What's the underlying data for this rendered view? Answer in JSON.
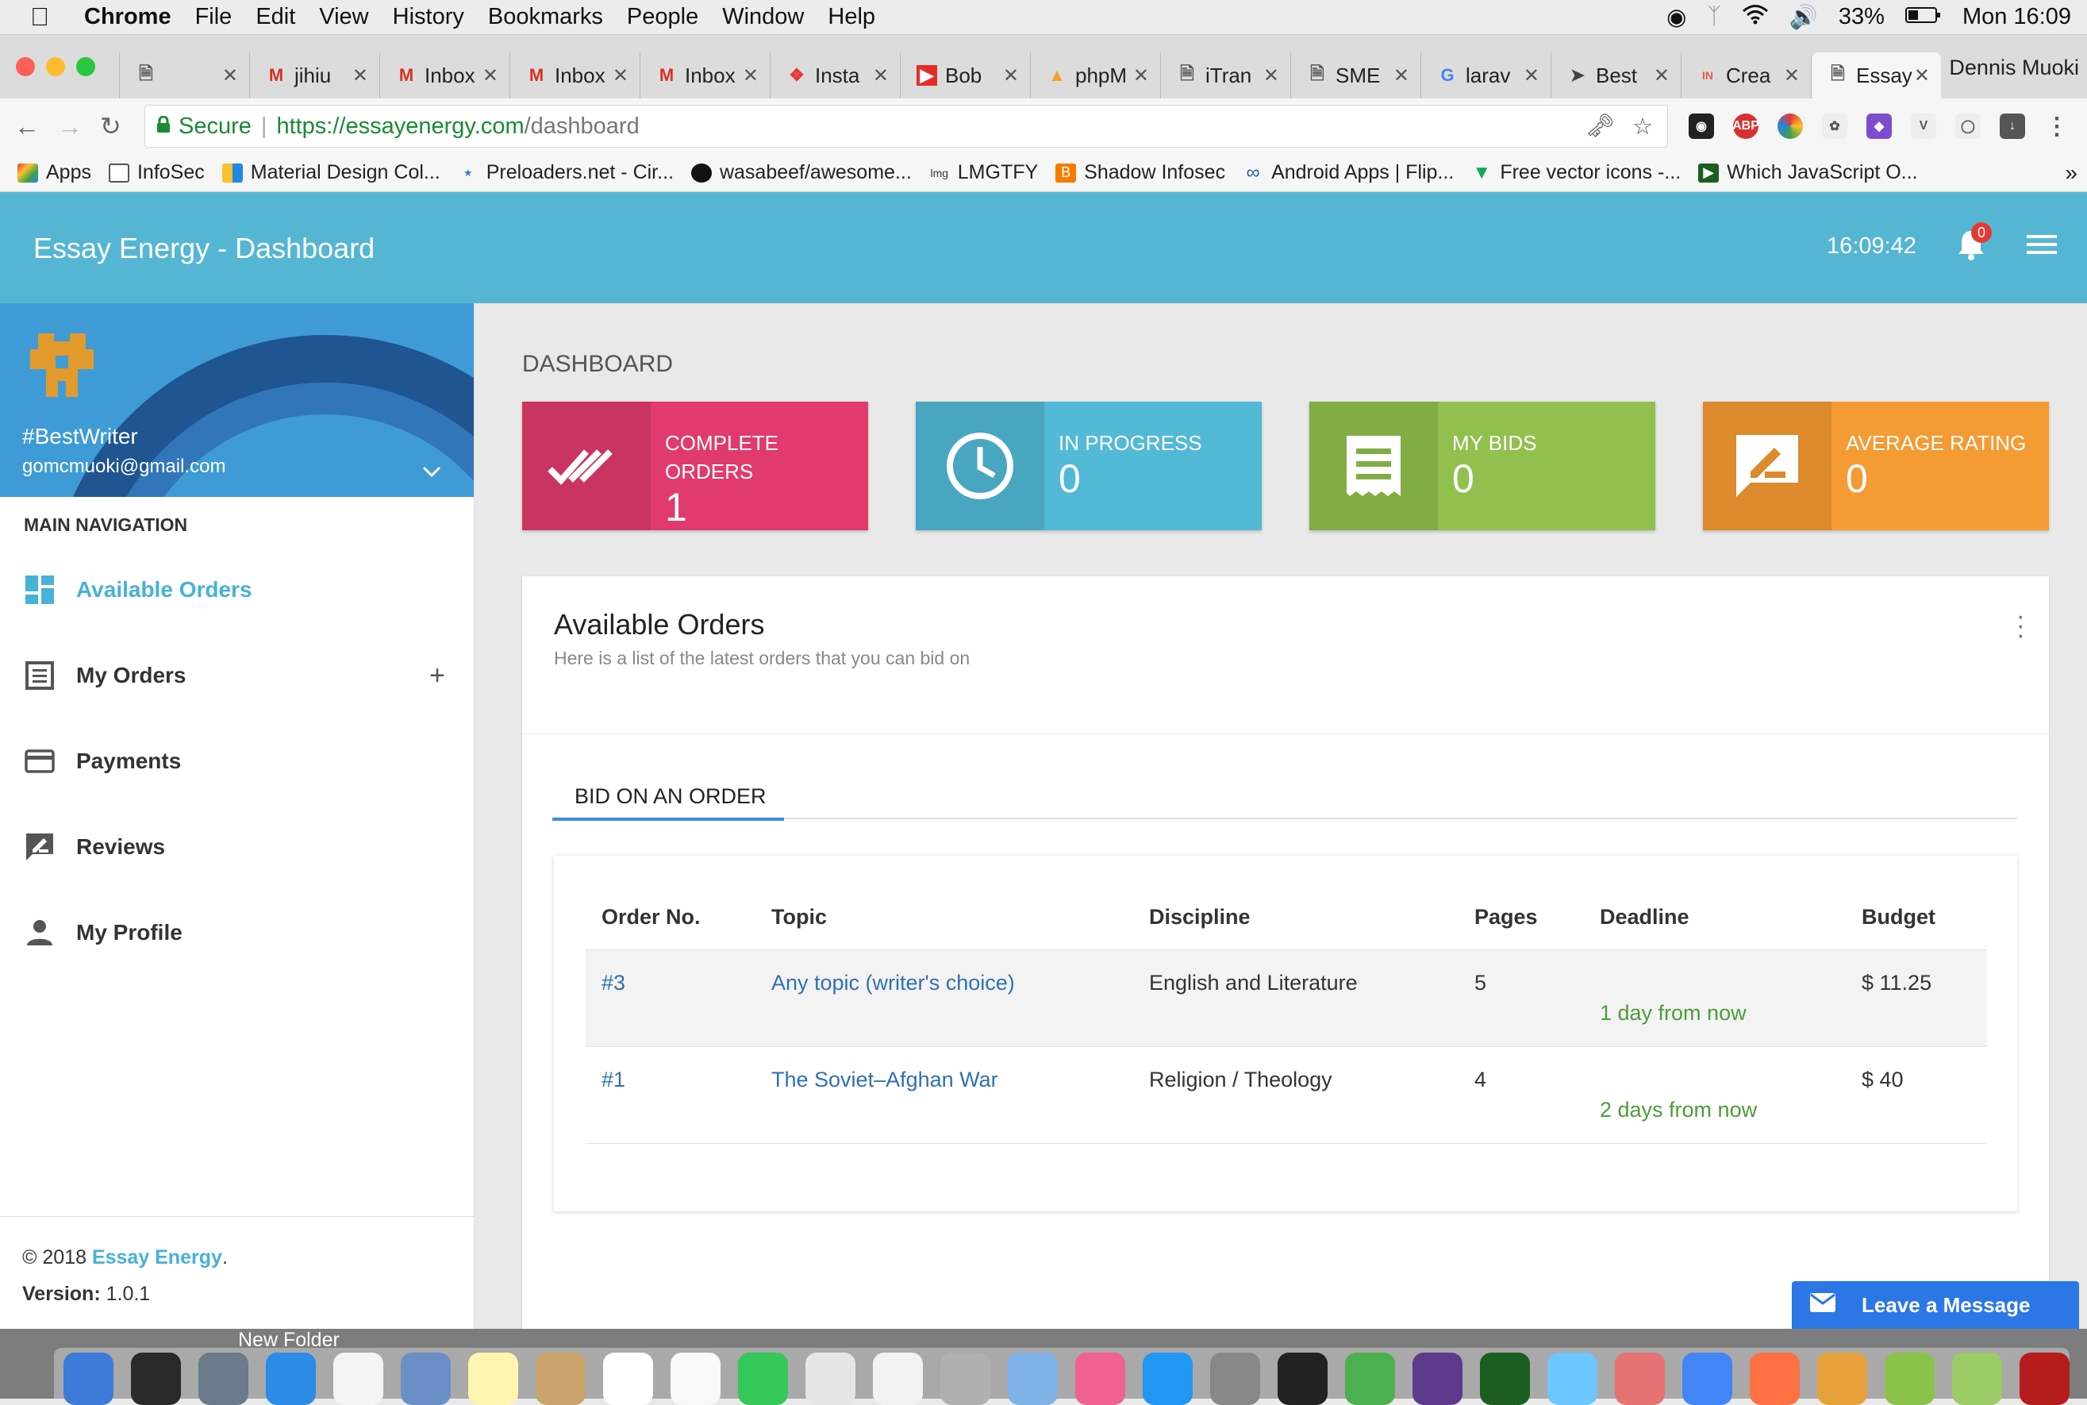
{
  "menubar": {
    "app": "Chrome",
    "items": [
      "File",
      "Edit",
      "View",
      "History",
      "Bookmarks",
      "People",
      "Window",
      "Help"
    ],
    "battery": "33%",
    "clock": "Mon 16:09"
  },
  "tabs": [
    {
      "label": "",
      "icon": "doc-icon"
    },
    {
      "label": "jihiu",
      "icon": "gmail-icon"
    },
    {
      "label": "Inbox",
      "icon": "gmail-icon"
    },
    {
      "label": "Inbox",
      "icon": "gmail-icon"
    },
    {
      "label": "Inbox",
      "icon": "gmail-icon"
    },
    {
      "label": "Insta",
      "icon": "insta-icon"
    },
    {
      "label": "Bob",
      "icon": "youtube-icon"
    },
    {
      "label": "phpM",
      "icon": "pma-icon"
    },
    {
      "label": "iTran",
      "icon": "doc-icon"
    },
    {
      "label": "SME",
      "icon": "doc-icon"
    },
    {
      "label": "larav",
      "icon": "google-icon"
    },
    {
      "label": "Best",
      "icon": "send-icon"
    },
    {
      "label": "Crea",
      "icon": "in-icon"
    },
    {
      "label": "Essay",
      "icon": "doc-icon",
      "active": true
    }
  ],
  "profile_name": "Dennis Muoki",
  "address": {
    "secure_label": "Secure",
    "host": "https://essayenergy.com",
    "path": "/dashboard"
  },
  "bookmarks": [
    "Apps",
    "InfoSec",
    "Material Design Col...",
    "Preloaders.net - Cir...",
    "wasabeef/awesome...",
    "LMGTFY",
    "Shadow Infosec",
    "Android Apps | Flip...",
    "Free vector icons -...",
    "Which JavaScript O..."
  ],
  "header": {
    "title": "Essay Energy - Dashboard",
    "time": "16:09:42",
    "notification_count": "0"
  },
  "user": {
    "name": "#BestWriter",
    "email": "gomcmuoki@gmail.com"
  },
  "nav": {
    "heading": "MAIN NAVIGATION",
    "items": [
      {
        "label": "Available Orders",
        "icon": "dashboard-icon"
      },
      {
        "label": "My Orders",
        "icon": "list-icon"
      },
      {
        "label": "Payments",
        "icon": "card-icon"
      },
      {
        "label": "Reviews",
        "icon": "rate-review-icon"
      },
      {
        "label": "My Profile",
        "icon": "person-icon"
      }
    ]
  },
  "footer": {
    "copyright": "© 2018",
    "brand": "Essay Energy",
    "period": ".",
    "version_label": "Version:",
    "version": "1.0.1"
  },
  "dashboard": {
    "title": "DASHBOARD",
    "cards": [
      {
        "label_line1": "COMPLETE",
        "label_line2": "ORDERS",
        "value": "1",
        "color": "#e03b6c",
        "icon_bg": "#c93460",
        "icon": "done-all-icon"
      },
      {
        "label_line1": "IN PROGRESS",
        "label_line2": "",
        "value": "0",
        "color": "#52b9d6",
        "icon_bg": "#48a6c0",
        "icon": "clock-icon"
      },
      {
        "label_line1": "MY BIDS",
        "label_line2": "",
        "value": "0",
        "color": "#92c04f",
        "icon_bg": "#81ad45",
        "icon": "receipt-icon"
      },
      {
        "label_line1": "AVERAGE RATING",
        "label_line2": "",
        "value": "0",
        "color": "#f49b33",
        "icon_bg": "#dc8a2b",
        "icon": "rate-review-icon"
      }
    ]
  },
  "panel": {
    "title": "Available Orders",
    "subtitle": "Here is a list of the latest orders that you can bid on",
    "tab": "BID ON AN ORDER"
  },
  "table": {
    "headers": [
      "Order No.",
      "Topic",
      "Discipline",
      "Pages",
      "Deadline",
      "Budget"
    ],
    "rows": [
      {
        "order": "#3",
        "topic": "Any topic (writer's choice)",
        "discipline": "English and Literature",
        "pages": "5",
        "deadline": "1 day from now",
        "budget": "$ 11.25"
      },
      {
        "order": "#1",
        "topic": "The Soviet–Afghan War",
        "discipline": "Religion / Theology",
        "pages": "4",
        "deadline": "2 days from now",
        "budget": "$ 40"
      }
    ]
  },
  "leave_message": "Leave a Message",
  "dock_folder": "New Folder"
}
